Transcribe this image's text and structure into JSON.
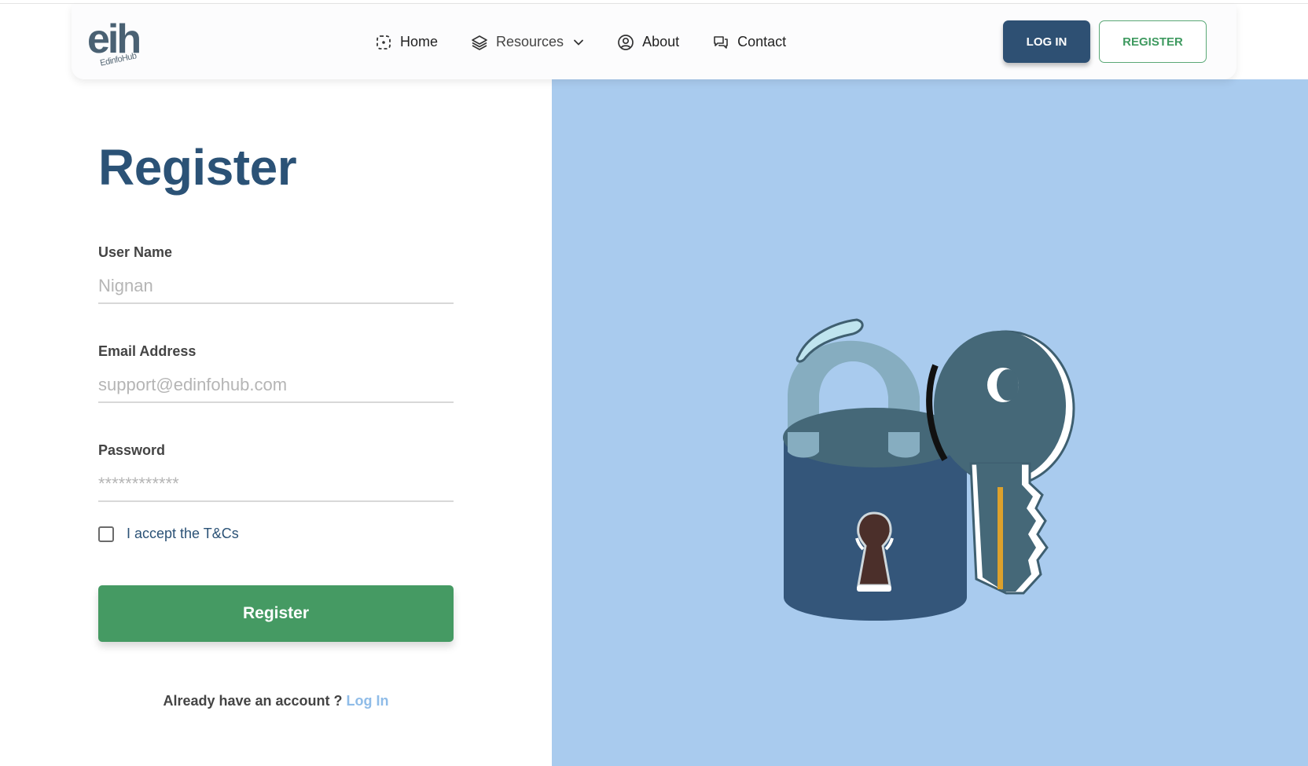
{
  "logo": {
    "main": "eih",
    "sub": "EdinfoHub"
  },
  "nav": {
    "items": [
      {
        "label": "Home",
        "icon": "home-dashed-icon"
      },
      {
        "label": "Resources",
        "icon": "layers-icon",
        "dropdown": true
      },
      {
        "label": "About",
        "icon": "user-circle-icon"
      },
      {
        "label": "Contact",
        "icon": "chat-bubbles-icon"
      }
    ],
    "login_label": "LOG IN",
    "register_label": "REGISTER"
  },
  "form": {
    "title": "Register",
    "username": {
      "label": "User Name",
      "placeholder": "Nignan"
    },
    "email": {
      "label": "Email Address",
      "placeholder": "support@edinfohub.com"
    },
    "password": {
      "label": "Password",
      "placeholder": "************"
    },
    "terms_label": "I accept the T&Cs",
    "submit_label": "Register",
    "account_prompt": "Already have an account ?",
    "login_link": "Log In"
  },
  "illustration": {
    "name": "padlock-and-key"
  },
  "colors": {
    "primary": "#2e5073",
    "accent_green": "#459a63",
    "panel_blue": "#a9cbee",
    "link_blue": "#8fbce8"
  }
}
